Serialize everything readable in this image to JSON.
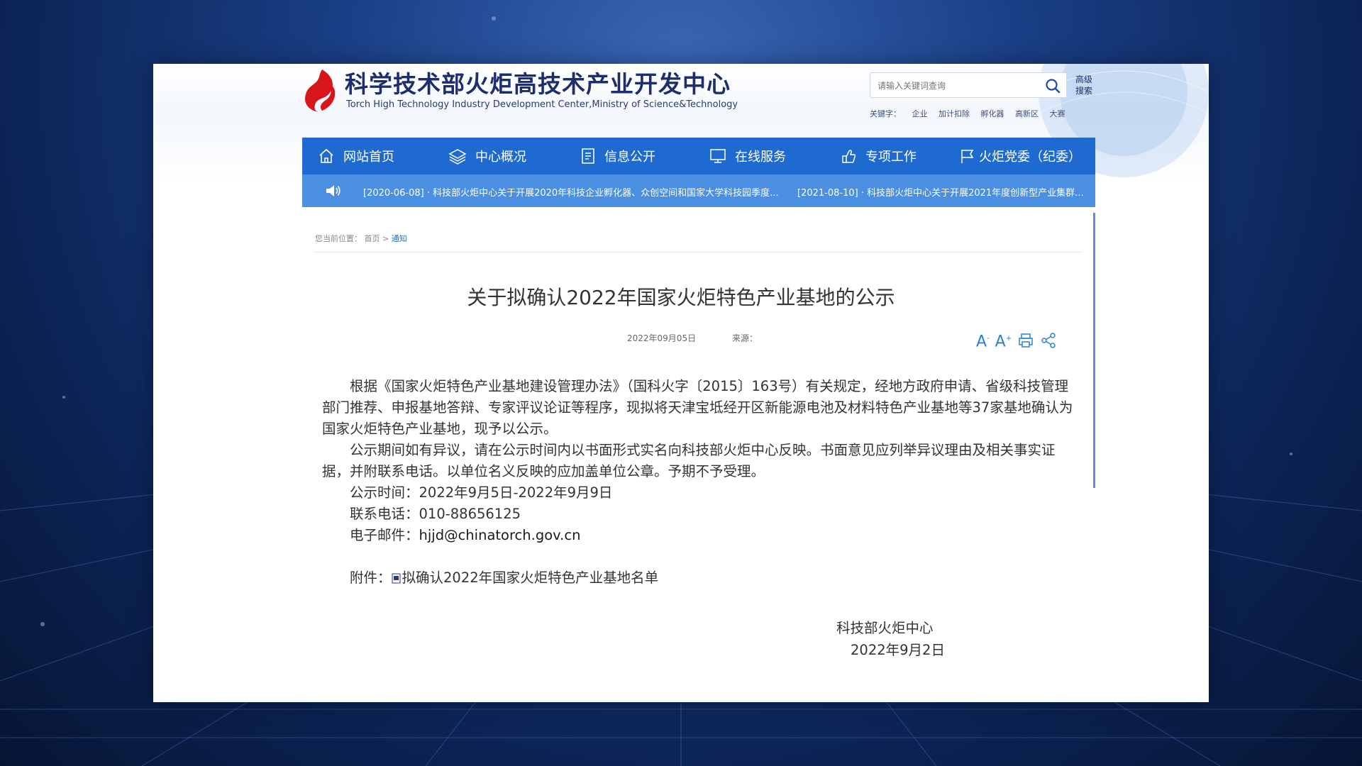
{
  "header": {
    "title": "科学技术部火炬高技术产业开发中心",
    "subtitle": "Torch High Technology Industry Development Center,Ministry of Science&Technology",
    "search_placeholder": "请输入关键词查询",
    "advanced_search": "高级搜索",
    "keywords_label": "关键字：",
    "keywords": [
      "企业",
      "加计扣除",
      "孵化器",
      "高新区",
      "大赛"
    ]
  },
  "nav": {
    "items": [
      {
        "label": "网站首页",
        "icon": "home-icon"
      },
      {
        "label": "中心概况",
        "icon": "layers-icon"
      },
      {
        "label": "信息公开",
        "icon": "document-icon"
      },
      {
        "label": "在线服务",
        "icon": "monitor-icon"
      },
      {
        "label": "专项工作",
        "icon": "hand-icon"
      },
      {
        "label": "火炬党委（纪委）",
        "icon": "flag-icon"
      }
    ]
  },
  "ticker": {
    "items": [
      "[2020-06-08] · 科技部火炬中心关于开展2020年科技企业孵化器、众创空间和国家大学科技园季度...",
      "[2021-08-10] · 科技部火炬中心关于开展2021年度创新型产业集群..."
    ]
  },
  "breadcrumb": {
    "prefix": "您当前位置：",
    "home": "首页",
    "separator": ">",
    "current": "通知"
  },
  "article": {
    "title": "关于拟确认2022年国家火炬特色产业基地的公示",
    "date": "2022年09月05日",
    "source_label": "来源：",
    "tools": [
      "A-",
      "A+",
      "print",
      "share"
    ],
    "paragraph1": "根据《国家火炬特色产业基地建设管理办法》（国科火字〔2015〕163号）有关规定，经地方政府申请、省级科技管理部门推荐、申报基地答辩、专家评议论证等程序，现拟将天津宝坻经开区新能源电池及材料特色产业基地等37家基地确认为国家火炬特色产业基地，现予以公示。",
    "paragraph2": "公示期间如有异议，请在公示时间内以书面形式实名向科技部火炬中心反映。书面意见应列举异议理由及相关事实证据，并附联系电话。以单位名义反映的应加盖单位公章。予期不予受理。",
    "period_label": "公示时间：",
    "period": "2022年9月5日-2022年9月9日",
    "phone_label": "联系电话：",
    "phone": "010-88656125",
    "email_label": "电子邮件：",
    "email": "hjjd@chinatorch.gov.cn",
    "attachment_label": "附件：",
    "attachment": "拟确认2022年国家火炬特色产业基地名单",
    "signature_org": "科技部火炬中心",
    "signature_date": "2022年9月2日"
  },
  "colors": {
    "nav_bg": "#1f6ad0",
    "ticker_bg": "#4a8fe2",
    "title_color": "#1d2e6f",
    "logo_red": "#d7161b",
    "link_blue": "#1f6ad0"
  }
}
